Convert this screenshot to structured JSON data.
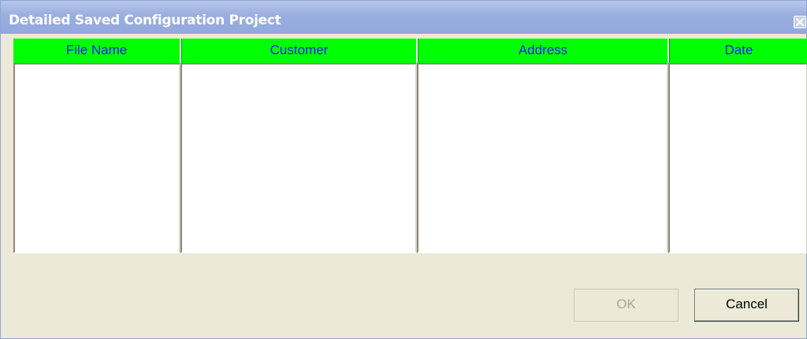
{
  "window": {
    "title": "Detailed Saved Configuration Project",
    "close_icon": "close-icon"
  },
  "table": {
    "columns": [
      "File Name",
      "Customer",
      "Address",
      "Date"
    ],
    "rows": [],
    "header_bg": "#00ff00",
    "header_text_color": "#1a1aff"
  },
  "buttons": {
    "ok_label": "OK",
    "ok_enabled": false,
    "cancel_label": "Cancel"
  }
}
